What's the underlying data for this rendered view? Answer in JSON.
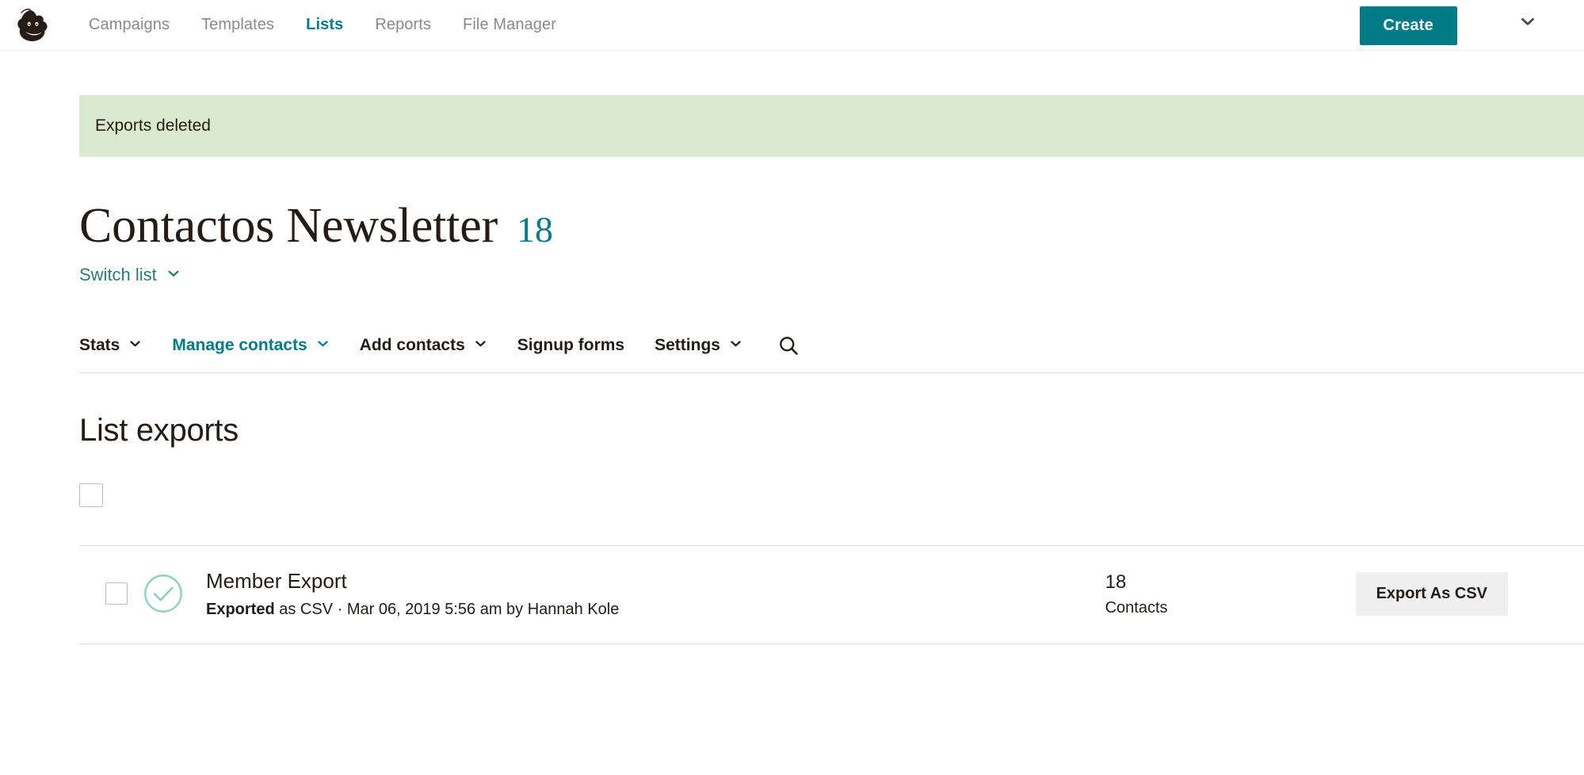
{
  "topnav": {
    "logo_name": "mailchimp-freddie-logo",
    "links": [
      {
        "label": "Campaigns",
        "active": false
      },
      {
        "label": "Templates",
        "active": false
      },
      {
        "label": "Lists",
        "active": true
      },
      {
        "label": "Reports",
        "active": false
      },
      {
        "label": "File Manager",
        "active": false
      }
    ],
    "create_button": "Create",
    "account_caret_icon": "chevron-down-icon",
    "accent_color": "#007c89",
    "inactive_color": "#8a8a8a"
  },
  "banner": {
    "message": "Exports deleted",
    "background_color": "#d9ead1"
  },
  "header": {
    "title": "Contactos Newsletter",
    "count": "18",
    "switch_list_label": "Switch list",
    "switch_list_caret_icon": "chevron-down-icon"
  },
  "subtabs": {
    "items": [
      {
        "label": "Stats",
        "has_caret": true,
        "active": false
      },
      {
        "label": "Manage contacts",
        "has_caret": true,
        "active": true
      },
      {
        "label": "Add contacts",
        "has_caret": true,
        "active": false
      },
      {
        "label": "Signup forms",
        "has_caret": false,
        "active": false
      },
      {
        "label": "Settings",
        "has_caret": true,
        "active": false
      }
    ],
    "search_icon": "search-icon"
  },
  "main": {
    "section_title": "List exports",
    "select_all_checkbox": "select-all-checkbox",
    "exports": [
      {
        "row_checkbox": "row-checkbox",
        "status_icon": "check-circle-icon",
        "status_color": "#8cd2bd",
        "title": "Member Export",
        "meta_status": "Exported",
        "meta_rest": " as CSV · Mar 06, 2019 5:56 am by Hannah Kole",
        "count": "18",
        "count_label": "Contacts",
        "action_label": "Export As CSV"
      }
    ]
  }
}
